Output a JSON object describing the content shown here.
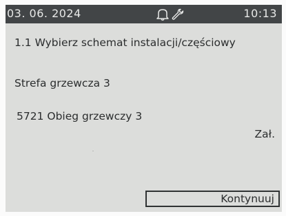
{
  "status_bar": {
    "date": "03. 06. 2024",
    "time": "10:13",
    "icons": [
      "bell-icon",
      "wrench-icon"
    ]
  },
  "menu": {
    "title": "1.1 Wybierz schemat instalacji/częściowy",
    "zone": "Strefa grzewcza 3",
    "parameter": {
      "label": "5721 Obieg grzewczy 3",
      "value": "Zał."
    }
  },
  "buttons": {
    "continue_label": "Kontynuuj"
  },
  "colors": {
    "screen_background": "#dcdddb",
    "status_bar_background": "#424547",
    "text": "#2b2d2e"
  }
}
